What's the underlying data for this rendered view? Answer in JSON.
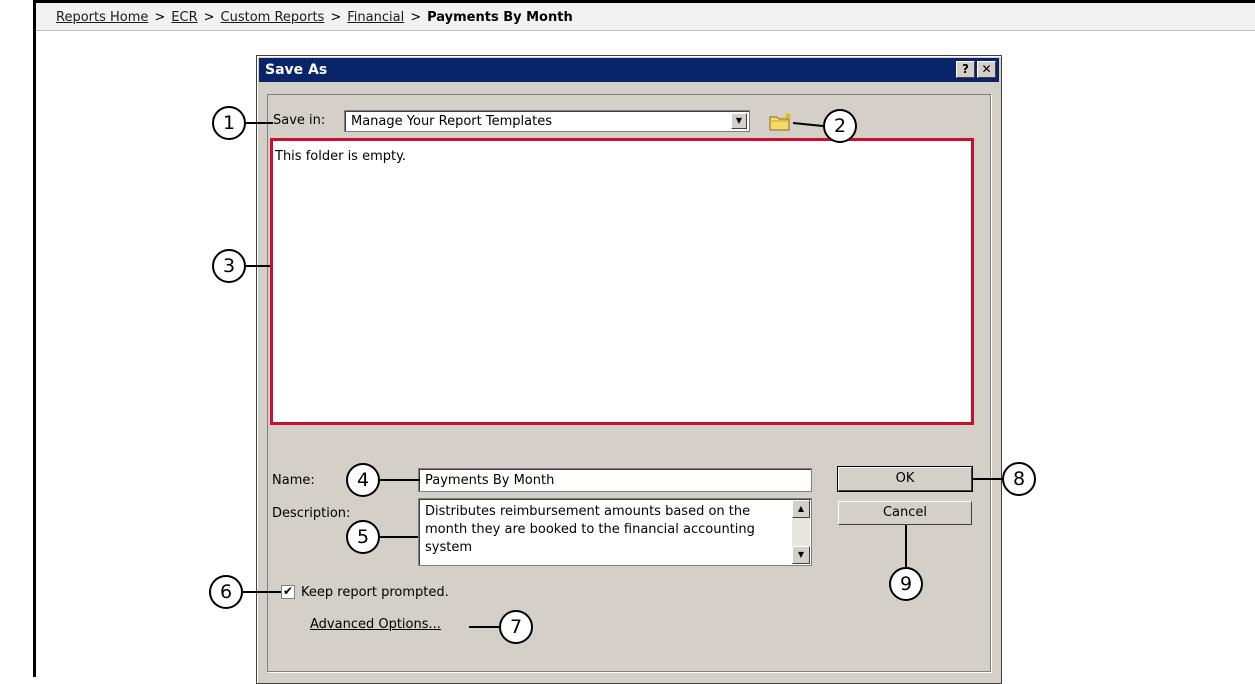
{
  "breadcrumb": {
    "items": [
      "Reports Home",
      "ECR",
      "Custom Reports",
      "Financial"
    ],
    "separator": ">",
    "current": "Payments By Month"
  },
  "dialog": {
    "title": "Save As",
    "help_label": "?",
    "close_label": "✕",
    "save_in_label": "Save in:",
    "save_in_value": "Manage Your Report Templates",
    "empty_message": "This folder is empty.",
    "name_label": "Name:",
    "name_value": "Payments By Month",
    "description_label": "Description:",
    "description_value": "Distributes reimbursement amounts based on the month they are booked to the financial accounting system",
    "keep_prompted_label": "Keep report prompted.",
    "keep_prompted_checked": true,
    "checkbox_mark": "✔",
    "advanced_options_label": "Advanced Options...",
    "ok_label": "OK",
    "cancel_label": "Cancel"
  },
  "callouts": [
    "1",
    "2",
    "3",
    "4",
    "5",
    "6",
    "7",
    "8",
    "9"
  ],
  "colors": {
    "highlight_border": "#c8102e",
    "titlebar": "#0a246a",
    "dialog_bg": "#d4d0c8"
  }
}
